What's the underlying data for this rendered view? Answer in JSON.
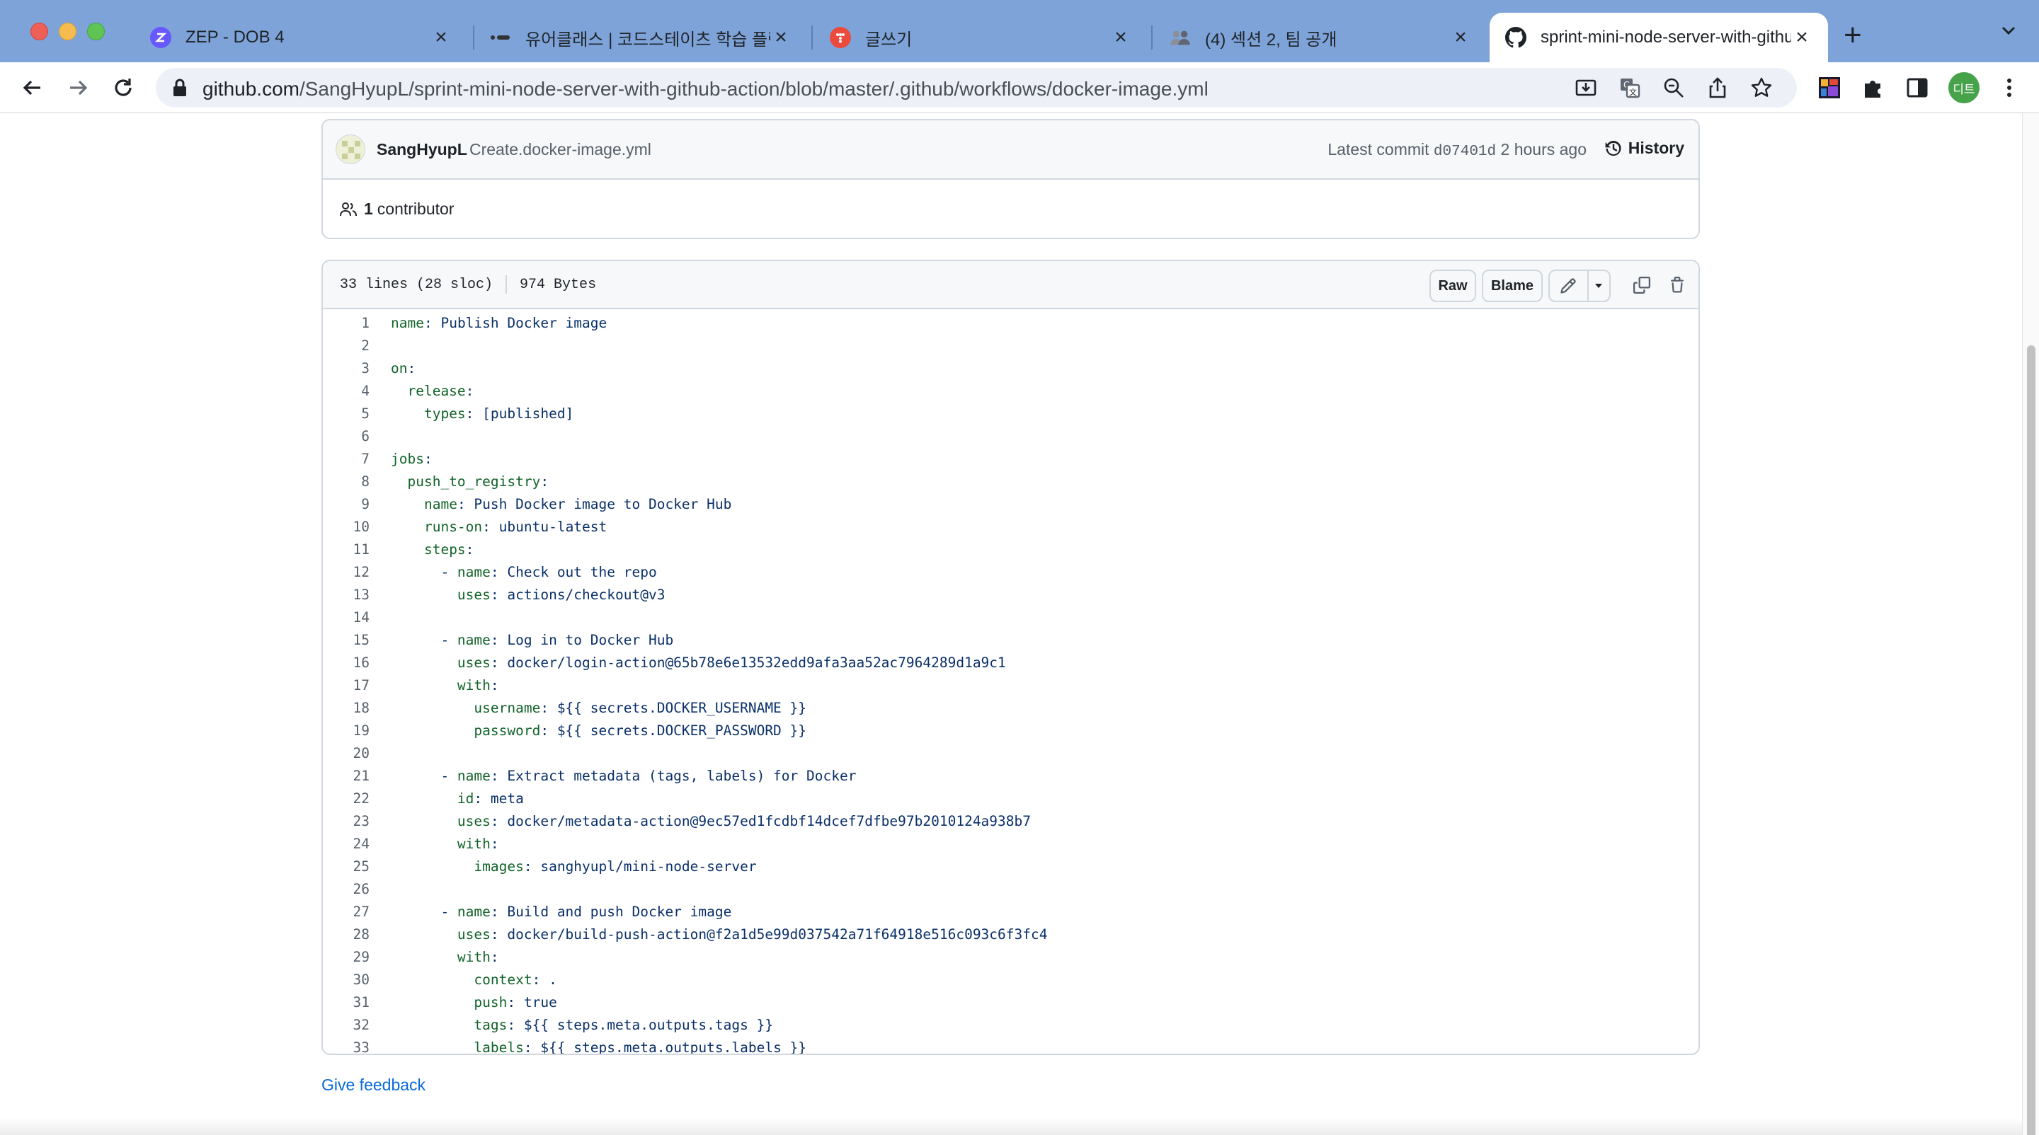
{
  "browser": {
    "tabs": [
      {
        "title": "ZEP - DOB 4",
        "icon": "zep-icon",
        "active": false
      },
      {
        "title": "유어클래스 | 코드스테이츠 학습 플랫폼",
        "icon": "codestates-icon",
        "active": false
      },
      {
        "title": "글쓰기",
        "icon": "tistory-icon",
        "active": false
      },
      {
        "title": "(4) 섹션 2, 팀 공개",
        "icon": "people-icon",
        "active": false
      },
      {
        "title": "sprint-mini-node-server-with-github-action",
        "icon": "github-icon",
        "active": true
      }
    ],
    "url_host": "github.com",
    "url_path": "/SangHyupL/sprint-mini-node-server-with-github-action/blob/master/.github/workflows/docker-image.yml",
    "profile_label": "디트"
  },
  "commit": {
    "author": "SangHyupL",
    "message": "Create.docker-image.yml",
    "latest_label": "Latest commit",
    "sha": "d07401d",
    "time": "2 hours ago",
    "history_label": "History",
    "contributors_count": "1",
    "contributors_label": "contributor"
  },
  "file": {
    "lines_info": "33 lines (28 sloc)",
    "size": "974 Bytes",
    "raw_label": "Raw",
    "blame_label": "Blame"
  },
  "code_lines": [
    {
      "n": "1",
      "indent": "",
      "key": "name",
      "val": " Publish Docker image"
    },
    {
      "n": "2",
      "indent": "",
      "key": "",
      "val": ""
    },
    {
      "n": "3",
      "indent": "",
      "key": "on",
      "val": ""
    },
    {
      "n": "4",
      "indent": "  ",
      "key": "release",
      "val": ""
    },
    {
      "n": "5",
      "indent": "    ",
      "key": "types",
      "val": " [published]"
    },
    {
      "n": "6",
      "indent": "",
      "key": "",
      "val": ""
    },
    {
      "n": "7",
      "indent": "",
      "key": "jobs",
      "val": ""
    },
    {
      "n": "8",
      "indent": "  ",
      "key": "push_to_registry",
      "val": ""
    },
    {
      "n": "9",
      "indent": "    ",
      "key": "name",
      "val": " Push Docker image to Docker Hub"
    },
    {
      "n": "10",
      "indent": "    ",
      "key": "runs-on",
      "val": " ubuntu-latest"
    },
    {
      "n": "11",
      "indent": "    ",
      "key": "steps",
      "val": ""
    },
    {
      "n": "12",
      "indent": "      - ",
      "key": "name",
      "val": " Check out the repo"
    },
    {
      "n": "13",
      "indent": "        ",
      "key": "uses",
      "val": " actions/checkout@v3"
    },
    {
      "n": "14",
      "indent": "",
      "key": "",
      "val": ""
    },
    {
      "n": "15",
      "indent": "      - ",
      "key": "name",
      "val": " Log in to Docker Hub"
    },
    {
      "n": "16",
      "indent": "        ",
      "key": "uses",
      "val": " docker/login-action@65b78e6e13532edd9afa3aa52ac7964289d1a9c1"
    },
    {
      "n": "17",
      "indent": "        ",
      "key": "with",
      "val": ""
    },
    {
      "n": "18",
      "indent": "          ",
      "key": "username",
      "val": " ${{ secrets.DOCKER_USERNAME }}"
    },
    {
      "n": "19",
      "indent": "          ",
      "key": "password",
      "val": " ${{ secrets.DOCKER_PASSWORD }}"
    },
    {
      "n": "20",
      "indent": "",
      "key": "",
      "val": ""
    },
    {
      "n": "21",
      "indent": "      - ",
      "key": "name",
      "val": " Extract metadata (tags, labels) for Docker"
    },
    {
      "n": "22",
      "indent": "        ",
      "key": "id",
      "val": " meta"
    },
    {
      "n": "23",
      "indent": "        ",
      "key": "uses",
      "val": " docker/metadata-action@9ec57ed1fcdbf14dcef7dfbe97b2010124a938b7"
    },
    {
      "n": "24",
      "indent": "        ",
      "key": "with",
      "val": ""
    },
    {
      "n": "25",
      "indent": "          ",
      "key": "images",
      "val": " sanghyupl/mini-node-server"
    },
    {
      "n": "26",
      "indent": "",
      "key": "",
      "val": ""
    },
    {
      "n": "27",
      "indent": "      - ",
      "key": "name",
      "val": " Build and push Docker image"
    },
    {
      "n": "28",
      "indent": "        ",
      "key": "uses",
      "val": " docker/build-push-action@f2a1d5e99d037542a71f64918e516c093c6f3fc4"
    },
    {
      "n": "29",
      "indent": "        ",
      "key": "with",
      "val": ""
    },
    {
      "n": "30",
      "indent": "          ",
      "key": "context",
      "val": " ."
    },
    {
      "n": "31",
      "indent": "          ",
      "key": "push",
      "val": " true"
    },
    {
      "n": "32",
      "indent": "          ",
      "key": "tags",
      "val": " ${{ steps.meta.outputs.tags }}"
    },
    {
      "n": "33",
      "indent": "          ",
      "key": "labels",
      "val": " ${{ steps.meta.outputs.labels }}"
    }
  ],
  "footer": {
    "feedback_label": "Give feedback"
  },
  "colors": {
    "tabbar": "#7ea3d8",
    "link": "#0969da",
    "yaml_key": "#116329",
    "yaml_value": "#0a3069"
  }
}
